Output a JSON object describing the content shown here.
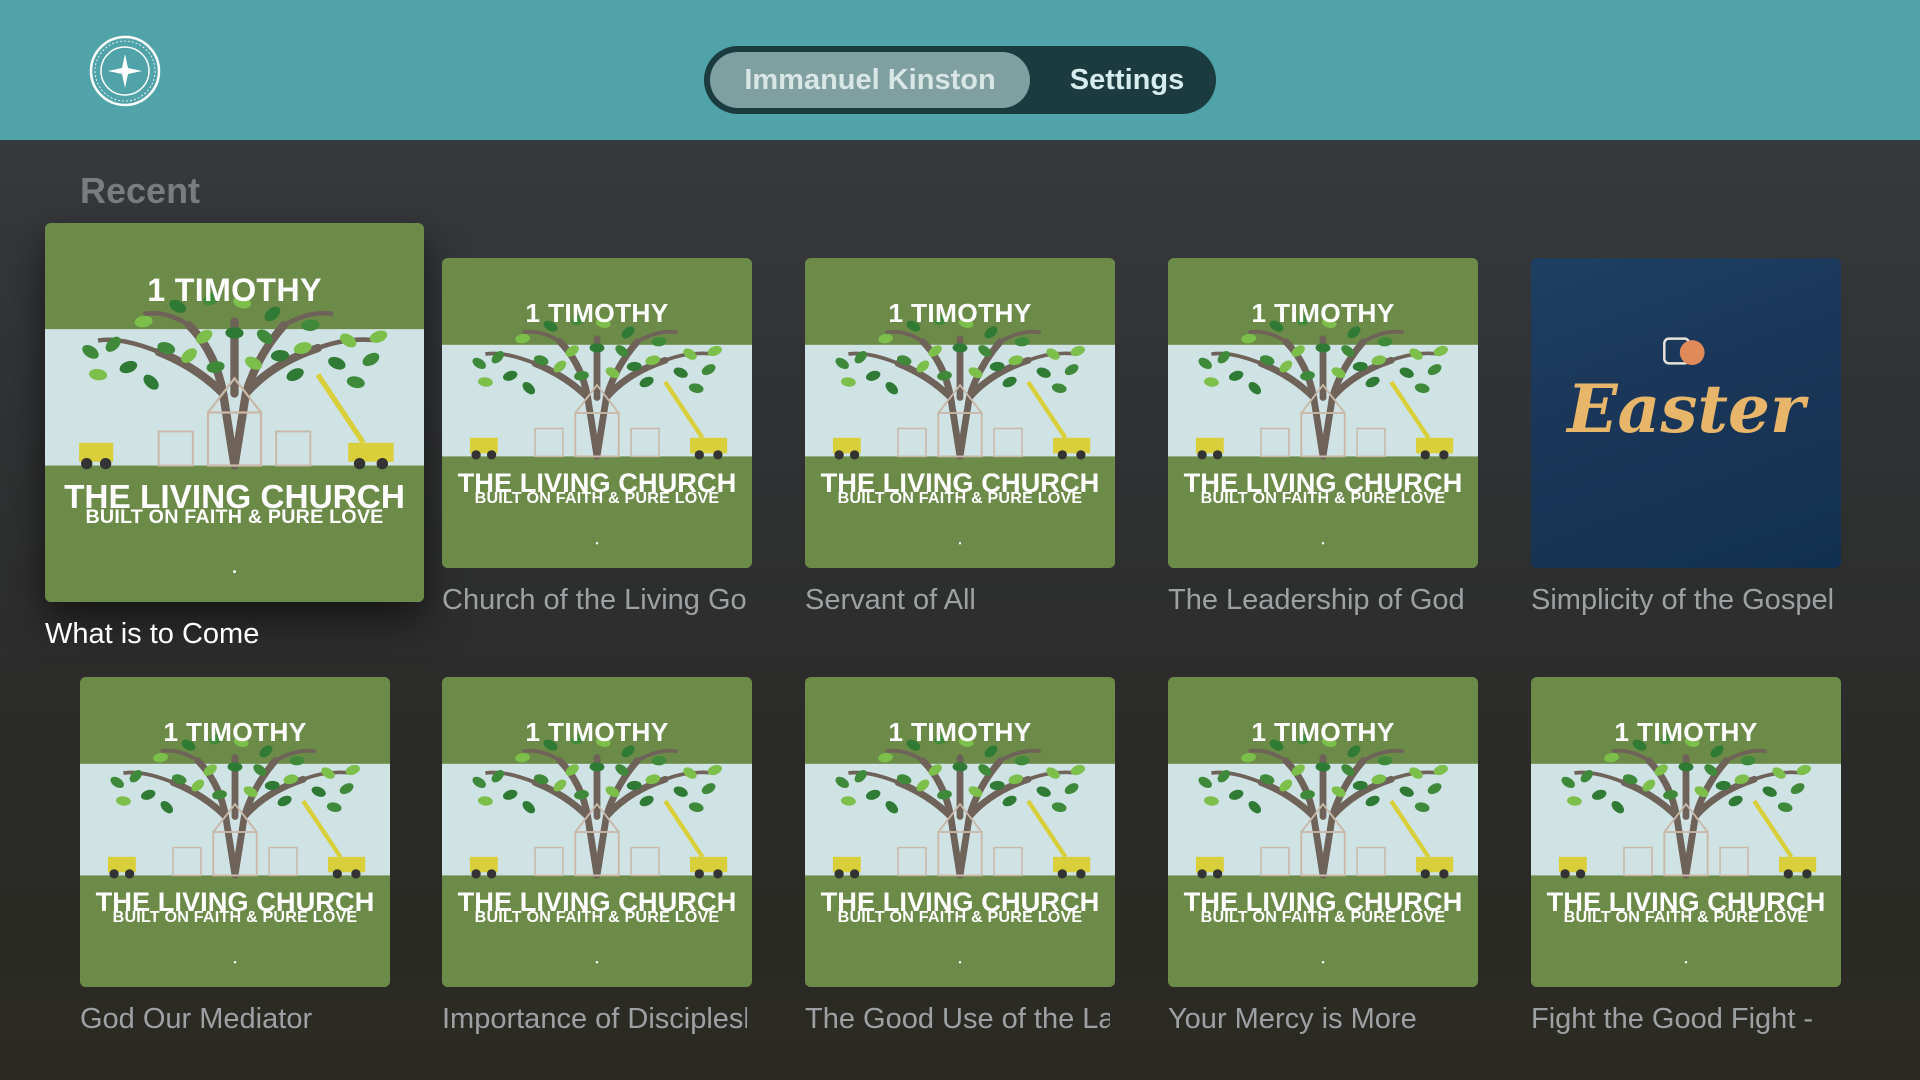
{
  "nav": {
    "tabs": [
      {
        "label": "Immanuel Kinston",
        "selected": true
      },
      {
        "label": "Settings",
        "selected": false
      }
    ]
  },
  "section": {
    "title": "Recent"
  },
  "cover": {
    "top": "1 TIMOTHY",
    "main": "THE LIVING CHURCH",
    "sub": "BUILT ON FAITH & PURE LOVE"
  },
  "easter_cover": {
    "word": "Easter"
  },
  "items": [
    {
      "title": "What is to Come",
      "art": "timothy",
      "focused": true
    },
    {
      "title": "Church of the Living God",
      "art": "timothy"
    },
    {
      "title": "Servant of All",
      "art": "timothy"
    },
    {
      "title": "The Leadership of God",
      "art": "timothy"
    },
    {
      "title": "Simplicity of the Gospel",
      "art": "easter"
    },
    {
      "title": "God Our Mediator",
      "art": "timothy"
    },
    {
      "title": "Importance of Discipleship",
      "art": "timothy"
    },
    {
      "title": "The Good Use of the Law",
      "art": "timothy"
    },
    {
      "title": "Your Mercy is More",
      "art": "timothy"
    },
    {
      "title": "Fight the Good Fight - ",
      "art": "timothy"
    }
  ],
  "colors": {
    "topbar": "#4fa3a9",
    "cover_green": "#6c8a48",
    "cover_sky": "#cfe3e5",
    "easter_gold": "#e7b66b",
    "easter_blue": "#1a3658"
  }
}
